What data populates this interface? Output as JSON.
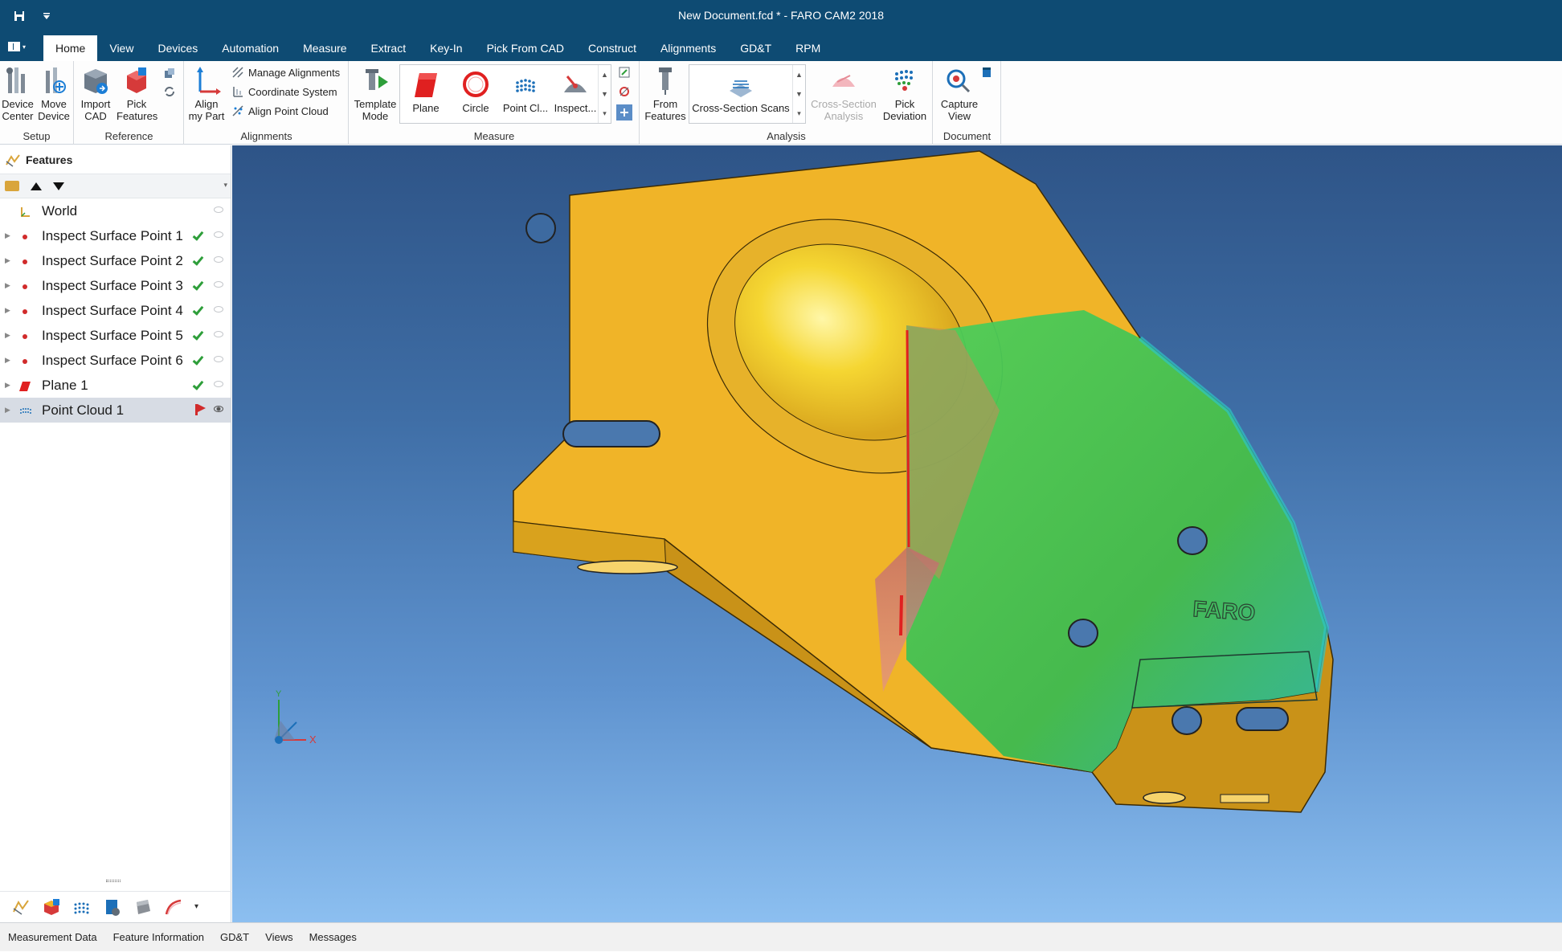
{
  "window": {
    "title": "New Document.fcd * - FARO CAM2 2018"
  },
  "tabs": [
    "Home",
    "View",
    "Devices",
    "Automation",
    "Measure",
    "Extract",
    "Key-In",
    "Pick From CAD",
    "Construct",
    "Alignments",
    "GD&T",
    "RPM"
  ],
  "ribbon": {
    "setup": {
      "label": "Setup",
      "device_center": "Device\nCenter",
      "move_device": "Move\nDevice"
    },
    "reference": {
      "label": "Reference",
      "import_cad": "Import\nCAD",
      "pick_features": "Pick\nFeatures"
    },
    "alignments": {
      "label": "Alignments",
      "align_my_part": "Align\nmy Part",
      "manage_alignments": "Manage Alignments",
      "coordinate_system": "Coordinate System",
      "align_point_cloud": "Align Point Cloud"
    },
    "measure": {
      "label": "Measure",
      "template_mode": "Template\nMode",
      "plane": "Plane",
      "circle": "Circle",
      "point_cloud": "Point Cl...",
      "inspect": "Inspect..."
    },
    "analysis": {
      "label": "Analysis",
      "from_features": "From\nFeatures",
      "cross_section_scans": "Cross-Section Scans",
      "cross_section_analysis": "Cross-Section\nAnalysis",
      "pick_deviation": "Pick\nDeviation"
    },
    "document": {
      "label": "Document",
      "capture_view": "Capture\nView"
    }
  },
  "features_panel": {
    "title": "Features",
    "items": [
      {
        "label": "World",
        "icon": "world-axis-icon",
        "status": ""
      },
      {
        "label": "Inspect Surface Point 1",
        "icon": "point-icon",
        "status": "ok"
      },
      {
        "label": "Inspect Surface Point 2",
        "icon": "point-icon",
        "status": "ok"
      },
      {
        "label": "Inspect Surface Point 3",
        "icon": "point-icon",
        "status": "ok"
      },
      {
        "label": "Inspect Surface Point 4",
        "icon": "point-icon",
        "status": "ok"
      },
      {
        "label": "Inspect Surface Point 5",
        "icon": "point-icon",
        "status": "ok"
      },
      {
        "label": "Inspect Surface Point 6",
        "icon": "point-icon",
        "status": "ok"
      },
      {
        "label": "Plane 1",
        "icon": "plane-icon",
        "status": "ok"
      },
      {
        "label": "Point Cloud 1",
        "icon": "point-cloud-icon",
        "status": "flag"
      }
    ]
  },
  "viewport": {
    "logo_text": "FARO",
    "axis_x": "X",
    "axis_y": "Y"
  },
  "statusbar": {
    "tabs": [
      "Measurement Data",
      "Feature Information",
      "GD&T",
      "Views",
      "Messages"
    ]
  },
  "colors": {
    "titlebar": "#0e4b73",
    "part_yellow": "#f0b428",
    "deviation_green": "#3dba4f",
    "check_green": "#2e9e3a",
    "flag_red": "#d12b2b"
  }
}
